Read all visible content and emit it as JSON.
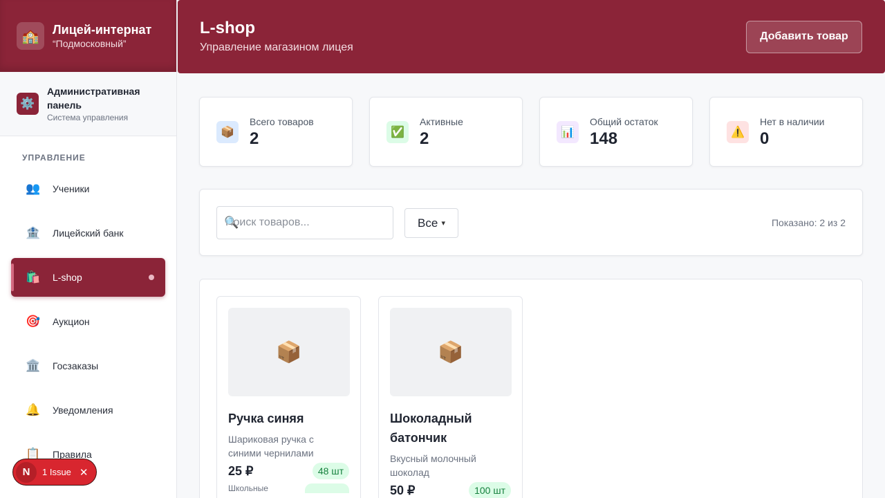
{
  "sidebar": {
    "brand_title": "Лицей-интернат",
    "brand_subtitle": "“Подмосковный”",
    "admin_title": "Административная панель",
    "admin_subtitle": "Система управления",
    "section_label": "УПРАВЛЕНИЕ",
    "items": [
      {
        "label": "Ученики",
        "icon": "👥",
        "icon_name": "students-icon"
      },
      {
        "label": "Лицейский банк",
        "icon": "🏦",
        "icon_name": "bank-icon"
      },
      {
        "label": "L-shop",
        "icon": "🛍️",
        "icon_name": "shopping-bags-icon"
      },
      {
        "label": "Аукцион",
        "icon": "🎯",
        "icon_name": "target-icon"
      },
      {
        "label": "Госзаказы",
        "icon": "🏛️",
        "icon_name": "government-icon"
      },
      {
        "label": "Уведомления",
        "icon": "🔔",
        "icon_name": "bell-icon"
      },
      {
        "label": "Правила",
        "icon": "📋",
        "icon_name": "clipboard-icon"
      }
    ]
  },
  "issue_badge": {
    "letter": "N",
    "text": "1 Issue"
  },
  "header": {
    "title": "L-shop",
    "subtitle": "Управление магазином лицея",
    "add_button": "Добавить товар"
  },
  "stats": [
    {
      "label": "Всего товаров",
      "value": "2",
      "icon": "📦",
      "bg": "#dbeafe"
    },
    {
      "label": "Активные",
      "value": "2",
      "icon": "✅",
      "bg": "#dcfce7"
    },
    {
      "label": "Общий остаток",
      "value": "148",
      "icon": "📊",
      "bg": "#f3e8ff"
    },
    {
      "label": "Нет в наличии",
      "value": "0",
      "icon": "⚠️",
      "bg": "#fee2e2"
    }
  ],
  "filters": {
    "search_placeholder": "Поиск товаров...",
    "select_value": "Все",
    "shown_text": "Показано: 2 из 2"
  },
  "products": [
    {
      "title": "Ручка синяя",
      "description": "Шариковая ручка с синими чернилами",
      "price": "25 ₽",
      "stock": "48 шт",
      "category": "Школьные"
    },
    {
      "title": "Шоколадный батончик",
      "description": "Вкусный молочный шоколад",
      "price": "50 ₽",
      "stock": "100 шт"
    }
  ],
  "colors": {
    "brand": "#8b2438",
    "stock_badge": "#dcfce7"
  }
}
